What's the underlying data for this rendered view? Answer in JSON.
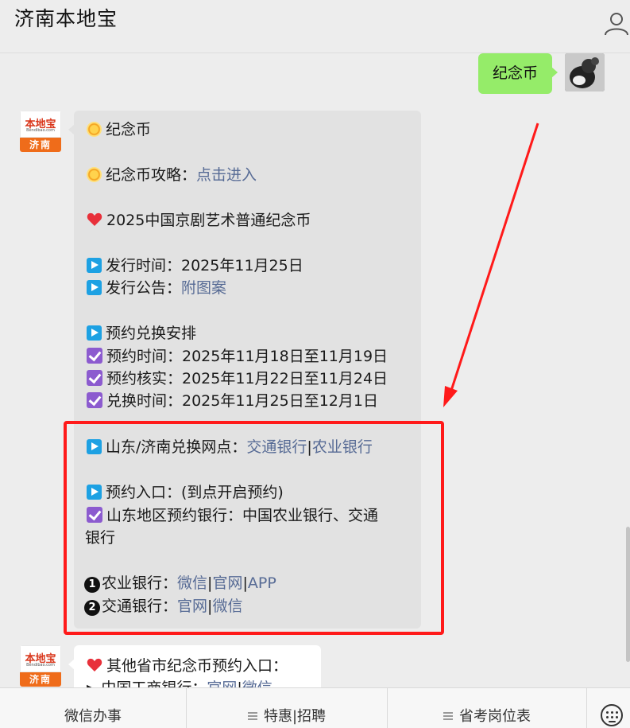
{
  "header": {
    "title": "济南本地宝",
    "user_icon": "person-icon"
  },
  "outgoing": {
    "text": "纪念币"
  },
  "bot": {
    "logo_text": "本地宝",
    "logo_sub": "Bendibao.com",
    "city": "济南"
  },
  "message1": {
    "l1": "纪念币",
    "l2_label": "纪念币攻略：",
    "l2_link": "点击进入",
    "l3": "2025中国京剧艺术普通纪念币",
    "l4": "发行时间：2025年11月25日",
    "l5_label": "发行公告：",
    "l5_link": "附图案",
    "l6": "预约兑换安排",
    "l7": "预约时间：2025年11月18日至11月19日",
    "l8": "预约核实：2025年11月22日至11月24日",
    "l9": "兑换时间：2025年11月25日至12月1日",
    "l10_label": "山东/济南兑换网点：",
    "l10_link1": "交通银行",
    "l10_sep": "|",
    "l10_link2": "农业银行",
    "l11": "预约入口：(到点开启预约)",
    "l12a": "山东地区预约银行：中国农业银行、交通",
    "l12b": "银行",
    "l13_num": "1",
    "l13_label": "农业银行：",
    "l13_link1": "微信",
    "l13_link2": "官网",
    "l13_link3": "APP",
    "l14_num": "2",
    "l14_label": "交通银行：",
    "l14_link1": "官网",
    "l14_link2": "微信"
  },
  "message2": {
    "l1": "其他省市纪念币预约入口：",
    "l2_label": "中国工商银行：",
    "l2_link1": "官网",
    "l2_sep": "|",
    "l2_link2": "微信"
  },
  "menu": {
    "item1": "微信办事",
    "item2": "特惠|招聘",
    "item3": "省考岗位表"
  },
  "colors": {
    "link": "#576b95",
    "outgoing_bubble": "#95ec69",
    "annotation_red": "#ff1a1a"
  }
}
